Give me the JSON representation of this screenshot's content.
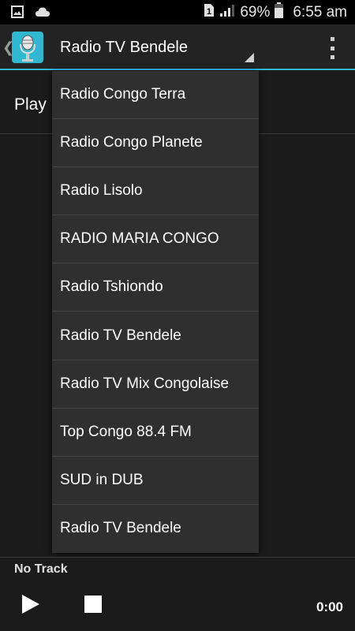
{
  "status_bar": {
    "left_icons": [
      "image-icon",
      "cloud-icon"
    ],
    "sim_badge": "1",
    "battery_percent": "69%",
    "time": "6:55 am"
  },
  "action_bar": {
    "selected_station": "Radio TV Bendele",
    "accent_color": "#33b5e5"
  },
  "content": {
    "play_label": "Play"
  },
  "dropdown": {
    "items": [
      "Radio Congo Terra",
      "Radio Congo Planete",
      "Radio Lisolo",
      "RADIO MARIA CONGO",
      "Radio Tshiondo",
      "Radio TV Bendele",
      "Radio TV Mix Congolaise",
      "Top Congo 88.4 FM",
      "SUD in DUB",
      "Radio TV Bendele"
    ]
  },
  "player": {
    "track": "No Track",
    "elapsed": "0:00"
  }
}
